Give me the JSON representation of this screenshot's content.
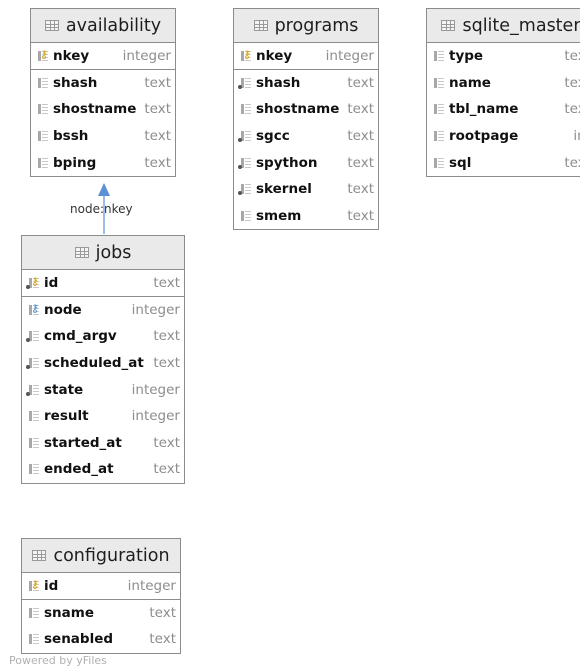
{
  "diagram": {
    "tables": [
      {
        "id": "availability",
        "name": "availability",
        "columns": [
          {
            "name": "nkey",
            "type": "integer",
            "kind": "pk"
          },
          {
            "name": "shash",
            "type": "text",
            "kind": "col"
          },
          {
            "name": "shostname",
            "type": "text",
            "kind": "col"
          },
          {
            "name": "bssh",
            "type": "text",
            "kind": "col"
          },
          {
            "name": "bping",
            "type": "text",
            "kind": "col"
          }
        ]
      },
      {
        "id": "programs",
        "name": "programs",
        "columns": [
          {
            "name": "nkey",
            "type": "integer",
            "kind": "pk"
          },
          {
            "name": "shash",
            "type": "text",
            "kind": "col-dot"
          },
          {
            "name": "shostname",
            "type": "text",
            "kind": "col"
          },
          {
            "name": "sgcc",
            "type": "text",
            "kind": "col-dot"
          },
          {
            "name": "spython",
            "type": "text",
            "kind": "col-dot"
          },
          {
            "name": "skernel",
            "type": "text",
            "kind": "col-dot"
          },
          {
            "name": "smem",
            "type": "text",
            "kind": "col"
          }
        ]
      },
      {
        "id": "sqlite_master",
        "name": "sqlite_master",
        "columns": [
          {
            "name": "type",
            "type": "text",
            "kind": "col"
          },
          {
            "name": "name",
            "type": "text",
            "kind": "col"
          },
          {
            "name": "tbl_name",
            "type": "text",
            "kind": "col"
          },
          {
            "name": "rootpage",
            "type": "int",
            "kind": "col"
          },
          {
            "name": "sql",
            "type": "text",
            "kind": "col"
          }
        ]
      },
      {
        "id": "jobs",
        "name": "jobs",
        "columns": [
          {
            "name": "id",
            "type": "text",
            "kind": "pk-dot"
          },
          {
            "name": "node",
            "type": "integer",
            "kind": "fk"
          },
          {
            "name": "cmd_argv",
            "type": "text",
            "kind": "col-dot"
          },
          {
            "name": "scheduled_at",
            "type": "text",
            "kind": "col-dot"
          },
          {
            "name": "state",
            "type": "integer",
            "kind": "col-dot"
          },
          {
            "name": "result",
            "type": "integer",
            "kind": "col"
          },
          {
            "name": "started_at",
            "type": "text",
            "kind": "col"
          },
          {
            "name": "ended_at",
            "type": "text",
            "kind": "col"
          }
        ]
      },
      {
        "id": "configuration",
        "name": "configuration",
        "columns": [
          {
            "name": "id",
            "type": "integer",
            "kind": "pk"
          },
          {
            "name": "sname",
            "type": "text",
            "kind": "col"
          },
          {
            "name": "senabled",
            "type": "text",
            "kind": "col"
          }
        ]
      }
    ],
    "relations": [
      {
        "from": "jobs",
        "to": "availability",
        "label": "node:nkey"
      }
    ],
    "footer": "Powered by yFiles",
    "colors": {
      "connector": "#5b8fd6",
      "header_bg": "#eaeaea",
      "key_icon": "#d8a400"
    }
  }
}
